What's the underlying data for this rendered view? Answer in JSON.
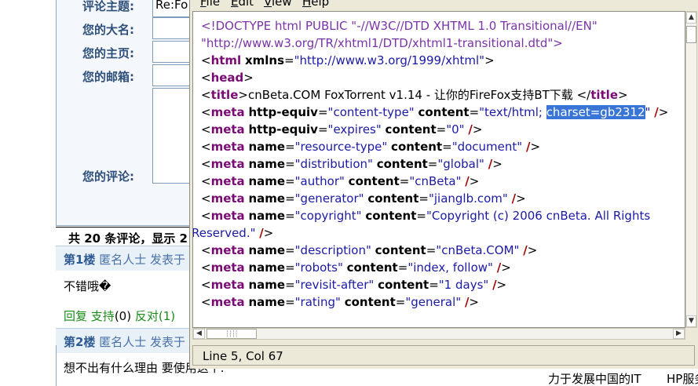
{
  "background_page": {
    "form": {
      "subject_label": "评论主题:",
      "subject_value": "Re:Fo",
      "name_label": "您的大名:",
      "homepage_label": "您的主页:",
      "email_label": "您的邮箱:",
      "comment_label": "您的评论:"
    },
    "comment_count": "共 20 条评论，显示 2",
    "floors": [
      {
        "floor": "第1楼",
        "author": "匿名人士 发表于",
        "body": "不错哦�"
      },
      {
        "floor": "第2楼",
        "author": "匿名人士 发表于",
        "body": "想不出有什么理由 要使用这个."
      }
    ],
    "actions": {
      "reply": "回复",
      "support": "支持",
      "support_count": "(0)",
      "oppose": "反对",
      "oppose_count": "(1)"
    },
    "footer": {
      "left": "力于发展中国的IT",
      "right": "HP服务"
    }
  },
  "viewer": {
    "menu": [
      {
        "label": "File",
        "key": "F"
      },
      {
        "label": "Edit",
        "key": "E"
      },
      {
        "label": "View",
        "key": "V"
      },
      {
        "label": "Help",
        "key": "H"
      }
    ],
    "source": {
      "doctype_1": "<!DOCTYPE html PUBLIC \"-//W3C//DTD XHTML 1.0 Transitional//EN\"",
      "doctype_2": "\"http://www.w3.org/TR/xhtml1/DTD/xhtml1-transitional.dtd\">",
      "html_xmlns": "\"http://www.w3.org/1999/xhtml\"",
      "title_text": "cnBeta.COM  FoxTorrent v1.14 - 让你的FireFox支持BT下载 ",
      "content_type_val_a": "\"text/html; ",
      "content_type_val_sel": "charset=gb2312",
      "content_type_val_b": "\"",
      "expires_val": "\"0\"",
      "meta_rows": [
        {
          "name": "\"resource-type\"",
          "content": "\"document\""
        },
        {
          "name": "\"distribution\"",
          "content": "\"global\""
        },
        {
          "name": "\"author\"",
          "content": "\"cnBeta\""
        },
        {
          "name": "\"generator\"",
          "content": "\"jianglb.com\""
        },
        {
          "name": "\"copyright\"",
          "content": "\"Copyright (c) 2006 cnBeta. All Rights"
        },
        {
          "name": "\"description\"",
          "content": "\"cnBeta.COM\""
        },
        {
          "name": "\"robots\"",
          "content": "\"index, follow\""
        },
        {
          "name": "\"revisit-after\"",
          "content": "\"1 days\""
        },
        {
          "name": "\"rating\"",
          "content": "\"general\""
        }
      ],
      "copyright_cont": "Reserved.\""
    },
    "status": "Line 5, Col 67"
  }
}
